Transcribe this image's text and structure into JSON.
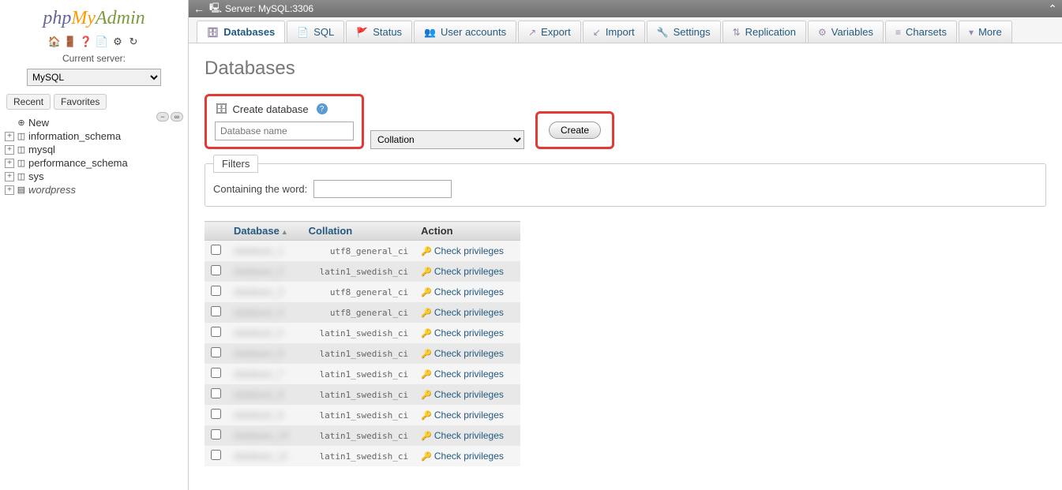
{
  "logo": {
    "php": "php",
    "my": "My",
    "admin": "Admin"
  },
  "sidebar": {
    "server_label": "Current server:",
    "server_value": "MySQL",
    "recent": "Recent",
    "favorites": "Favorites",
    "tree": [
      {
        "name": "New",
        "cls": "new",
        "icon": "⊕"
      },
      {
        "name": "information_schema",
        "cls": "",
        "icon": "◫"
      },
      {
        "name": "mysql",
        "cls": "",
        "icon": "◫"
      },
      {
        "name": "performance_schema",
        "cls": "",
        "icon": "◫"
      },
      {
        "name": "sys",
        "cls": "",
        "icon": "◫"
      },
      {
        "name": "wordpress",
        "cls": "wp",
        "icon": "▤"
      }
    ]
  },
  "topbar": {
    "server": "Server: MySQL:3306"
  },
  "tabs": [
    {
      "label": "Databases",
      "icon": "🗄",
      "active": true
    },
    {
      "label": "SQL",
      "icon": "📄",
      "active": false
    },
    {
      "label": "Status",
      "icon": "🚩",
      "active": false
    },
    {
      "label": "User accounts",
      "icon": "👥",
      "active": false
    },
    {
      "label": "Export",
      "icon": "↗",
      "active": false
    },
    {
      "label": "Import",
      "icon": "↙",
      "active": false
    },
    {
      "label": "Settings",
      "icon": "🔧",
      "active": false
    },
    {
      "label": "Replication",
      "icon": "⇅",
      "active": false
    },
    {
      "label": "Variables",
      "icon": "⚙",
      "active": false
    },
    {
      "label": "Charsets",
      "icon": "≡",
      "active": false
    },
    {
      "label": "More",
      "icon": "▾",
      "active": false
    }
  ],
  "page": {
    "title": "Databases",
    "create": {
      "heading": "Create database",
      "placeholder": "Database name",
      "collation": "Collation",
      "button": "Create"
    },
    "filters": {
      "tab": "Filters",
      "label": "Containing the word:"
    },
    "table": {
      "headers": {
        "database": "Database",
        "collation": "Collation",
        "action": "Action"
      },
      "action_link": "Check privileges",
      "rows": [
        {
          "collation": "utf8_general_ci"
        },
        {
          "collation": "latin1_swedish_ci"
        },
        {
          "collation": "utf8_general_ci"
        },
        {
          "collation": "utf8_general_ci"
        },
        {
          "collation": "latin1_swedish_ci"
        },
        {
          "collation": "latin1_swedish_ci"
        },
        {
          "collation": "latin1_swedish_ci"
        },
        {
          "collation": "latin1_swedish_ci"
        },
        {
          "collation": "latin1_swedish_ci"
        },
        {
          "collation": "latin1_swedish_ci"
        },
        {
          "collation": "latin1_swedish_ci"
        }
      ]
    }
  }
}
